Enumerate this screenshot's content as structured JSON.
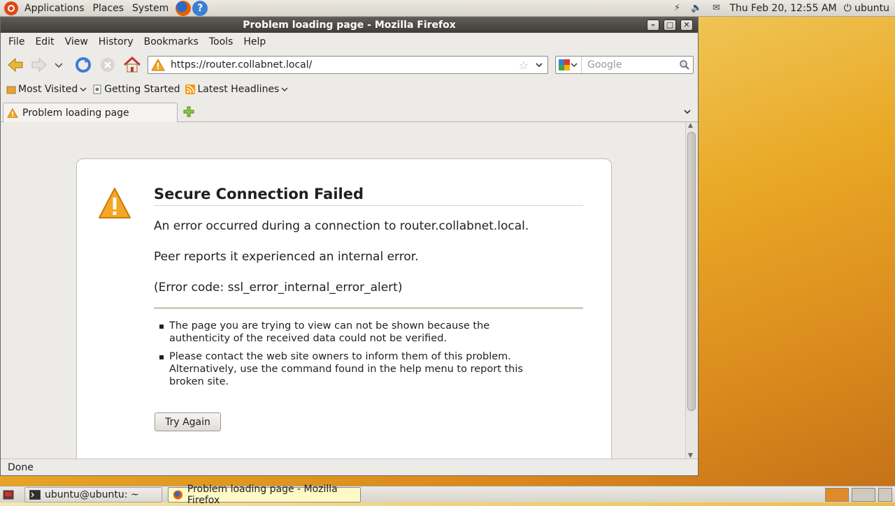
{
  "top_panel": {
    "menus": [
      "Applications",
      "Places",
      "System"
    ],
    "clock": "Thu Feb 20, 12:55 AM",
    "user": "ubuntu"
  },
  "window": {
    "title": "Problem loading page - Mozilla Firefox",
    "menubar": [
      "File",
      "Edit",
      "View",
      "History",
      "Bookmarks",
      "Tools",
      "Help"
    ],
    "url": "https://router.collabnet.local/",
    "search_placeholder": "Google",
    "bookmarks": [
      "Most Visited",
      "Getting Started",
      "Latest Headlines"
    ],
    "tab_title": "Problem loading page",
    "status": "Done"
  },
  "error_page": {
    "title": "Secure Connection Failed",
    "line1": "An error occurred during a connection to router.collabnet.local.",
    "line2": "Peer reports it experienced an internal error.",
    "line3": "(Error code: ssl_error_internal_error_alert)",
    "bullets": [
      "The page you are trying to view can not be shown because the authenticity of the received data could not be verified.",
      "Please contact the web site owners to inform them of this problem. Alternatively, use the command found in the help menu to report this broken site."
    ],
    "try_again": "Try Again"
  },
  "taskbar": {
    "items": [
      "ubuntu@ubuntu: ~",
      "Problem loading page - Mozilla Firefox"
    ]
  }
}
